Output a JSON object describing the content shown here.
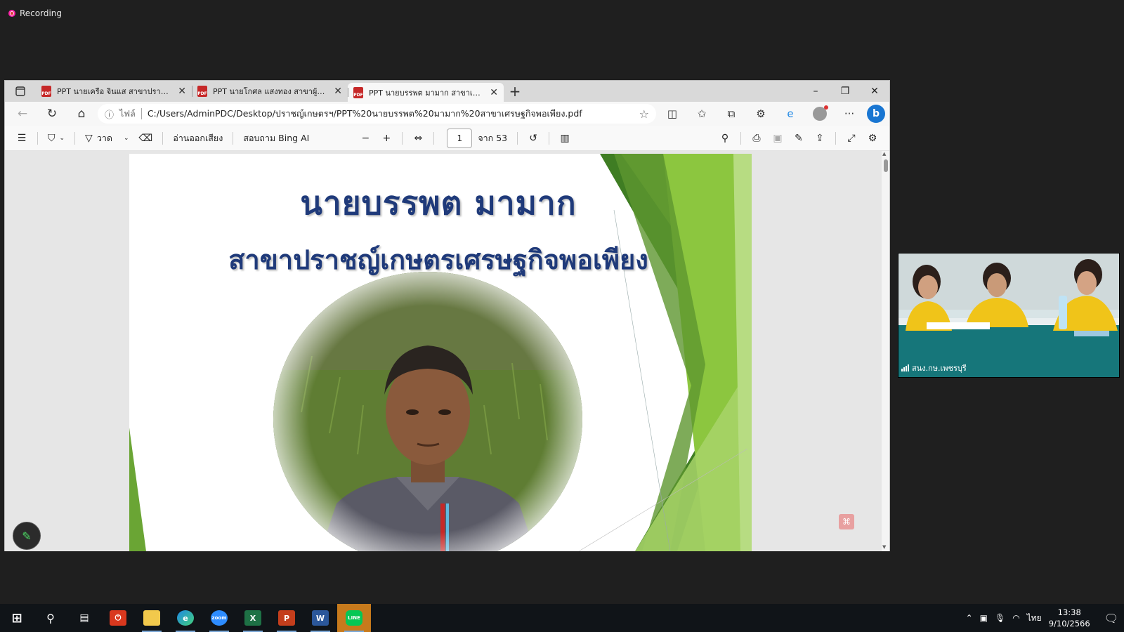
{
  "recording": {
    "label": "Recording"
  },
  "browser": {
    "tabs": [
      {
        "label": "PPT นายเครือ จินแส สาขาปราชญ์เกษ",
        "active": false
      },
      {
        "label": "PPT นายโกศล แสงทอง สาขาผู้นำชุมช",
        "active": false
      },
      {
        "label": "PPT นายบรรพต มามาก สาขาเศรษฐกิ",
        "active": true
      }
    ],
    "window_controls": {
      "minimize": "–",
      "restore": "❐",
      "close": "✕"
    },
    "address": {
      "scheme_label": "ไฟล์",
      "url": "C:/Users/AdminPDC/Desktop/ปราชญ์เกษตรฯ/PPT%20นายบรรพต%20มามาก%20สาขาเศรษฐกิจพอเพียง.pdf"
    }
  },
  "pdf_toolbar": {
    "draw_label": "วาด",
    "read_aloud_label": "อ่านออกเสียง",
    "ask_bing_label": "สอบถาม Bing AI",
    "page_current": "1",
    "page_total_label": "จาก 53"
  },
  "slide": {
    "title": "นายบรรพต  มามาก",
    "subtitle": "สาขาปราชญ์เกษตรเศรษฐกิจพอเพียง",
    "accent_colors": [
      "#4f7f2a",
      "#7cb342",
      "#a5d36b",
      "#c8e6a0"
    ]
  },
  "video": {
    "participant_name": "สนง.กษ.เพชรบุรี"
  },
  "taskbar": {
    "apps": [
      {
        "name": "start",
        "glyph": "⊞"
      },
      {
        "name": "search",
        "glyph": "⚲"
      },
      {
        "name": "task-view",
        "glyph": "▤"
      },
      {
        "name": "antivirus",
        "glyph": "⏻"
      },
      {
        "name": "file-explorer",
        "glyph": "▬"
      },
      {
        "name": "edge",
        "glyph": "e"
      },
      {
        "name": "zoom",
        "glyph": "zoom"
      },
      {
        "name": "excel",
        "glyph": "X"
      },
      {
        "name": "powerpoint",
        "glyph": "P"
      },
      {
        "name": "word",
        "glyph": "W"
      },
      {
        "name": "line",
        "glyph": "LINE"
      }
    ],
    "language": "ไทย",
    "time": "13:38",
    "date": "9/10/2566"
  }
}
